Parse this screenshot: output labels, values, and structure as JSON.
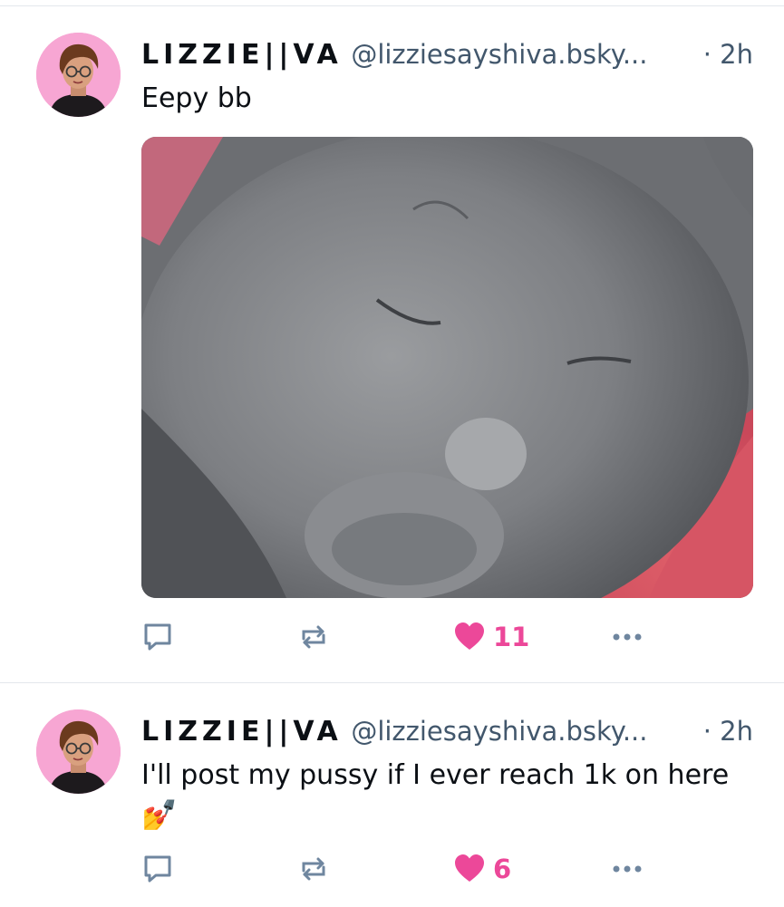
{
  "colors": {
    "accent_like": "#ec4899",
    "secondary_text": "#42576c",
    "avatar_bg": "#f7a6d3",
    "divider": "#e3e7ec"
  },
  "posts": [
    {
      "author": {
        "display_name": "LIZZIE||VA",
        "handle": "@lizziesayshiva.bsky..."
      },
      "time": "· 2h",
      "text": "Eepy bb",
      "emoji": "",
      "has_image": true,
      "likes": "11",
      "icons": [
        "reply-icon",
        "repost-icon",
        "heart-icon",
        "more-icon"
      ]
    },
    {
      "author": {
        "display_name": "LIZZIE||VA",
        "handle": "@lizziesayshiva.bsky..."
      },
      "time": "· 2h",
      "text": "I'll post my pussy if I ever reach 1k on here",
      "emoji": "💅",
      "has_image": false,
      "likes": "6",
      "icons": [
        "reply-icon",
        "repost-icon",
        "heart-icon",
        "more-icon"
      ]
    }
  ]
}
